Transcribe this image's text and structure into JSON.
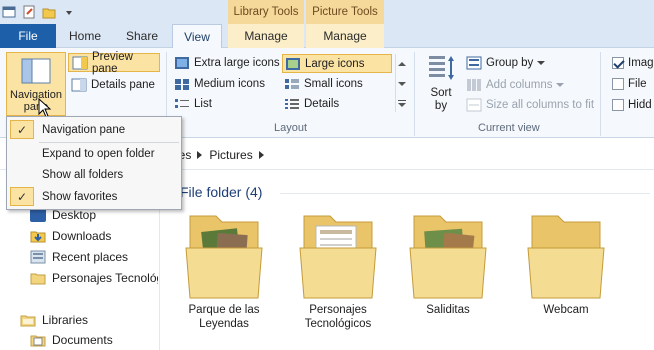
{
  "titlebar": {
    "context_groups": [
      "Library Tools",
      "Picture Tools"
    ]
  },
  "tabs": {
    "file": "File",
    "home": "Home",
    "share": "Share",
    "view": "View",
    "manage_library": "Manage",
    "manage_picture": "Manage"
  },
  "ribbon": {
    "panes": {
      "navigation_pane": "Navigation pane",
      "preview_pane": "Preview pane",
      "details_pane": "Details pane"
    },
    "layout": {
      "label": "Layout",
      "options": [
        "Extra large icons",
        "Large icons",
        "Medium icons",
        "Small icons",
        "List",
        "Details"
      ],
      "selected": "Large icons"
    },
    "current_view": {
      "label": "Current view",
      "sort_by": "Sort by",
      "group_by": "Group by",
      "add_columns": "Add columns",
      "size_columns": "Size all columns to fit"
    },
    "show_hide": {
      "items": [
        "Imag",
        "File",
        "Hidd"
      ],
      "checked": [
        true,
        false,
        false
      ]
    }
  },
  "dropdown": {
    "items": [
      {
        "label": "Navigation pane",
        "checked": true
      },
      {
        "label": "Expand to open folder",
        "checked": false
      },
      {
        "label": "Show all folders",
        "checked": false
      },
      {
        "label": "Show favorites",
        "checked": true
      }
    ]
  },
  "breadcrumb": [
    "ies",
    "Pictures"
  ],
  "navpane": {
    "items": [
      {
        "label": "Desktop",
        "icon": "desktop-icon"
      },
      {
        "label": "Downloads",
        "icon": "downloads-icon"
      },
      {
        "label": "Recent places",
        "icon": "recent-places-icon"
      },
      {
        "label": "Personajes Tecnológ",
        "icon": "folder-icon"
      },
      {
        "label": "Libraries",
        "icon": "libraries-icon"
      },
      {
        "label": "Documents",
        "icon": "documents-icon"
      }
    ]
  },
  "content": {
    "group_heading": "File folder (4)",
    "folders": [
      {
        "name": "Parque de las Leyendas"
      },
      {
        "name": "Personajes Tecnológicos"
      },
      {
        "name": "Saliditas"
      },
      {
        "name": "Webcam"
      }
    ]
  },
  "colors": {
    "file_tab": "#1d5fa8",
    "context_tab": "#f4d99a",
    "selected": "#fbe3a4",
    "folder": "#f2d57e"
  }
}
